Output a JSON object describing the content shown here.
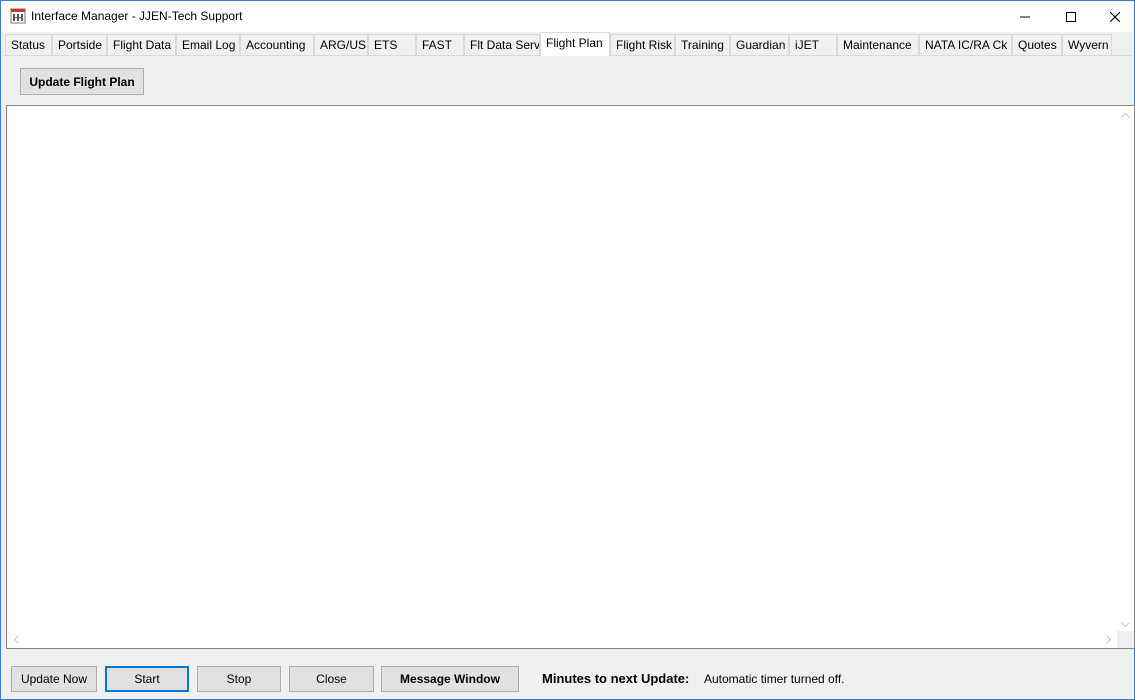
{
  "window": {
    "title": "Interface Manager - JJEN-Tech Support"
  },
  "tabs": [
    {
      "label": "Status"
    },
    {
      "label": "Portside"
    },
    {
      "label": "Flight Data"
    },
    {
      "label": "Email Log"
    },
    {
      "label": "Accounting"
    },
    {
      "label": "ARG/US"
    },
    {
      "label": "ETS"
    },
    {
      "label": "FAST"
    },
    {
      "label": "Flt Data Serv"
    },
    {
      "label": "Flight Plan"
    },
    {
      "label": "Flight Risk"
    },
    {
      "label": "Training"
    },
    {
      "label": "Guardian"
    },
    {
      "label": "iJET"
    },
    {
      "label": "Maintenance"
    },
    {
      "label": "NATA IC/RA Ck"
    },
    {
      "label": "Quotes"
    },
    {
      "label": "Wyvern"
    }
  ],
  "active_tab": "Flight Plan",
  "panel": {
    "update_button": "Update Flight Plan",
    "log_text": ""
  },
  "footer": {
    "update_now": "Update Now",
    "start": "Start",
    "stop": "Stop",
    "close": "Close",
    "message_window": "Message Window",
    "minutes_label": "Minutes to next Update:",
    "timer_status": "Automatic timer turned off."
  },
  "colors": {
    "accent": "#0078d7",
    "window_border": "#3a7bd5",
    "tab_border": "#d9d9d9"
  }
}
